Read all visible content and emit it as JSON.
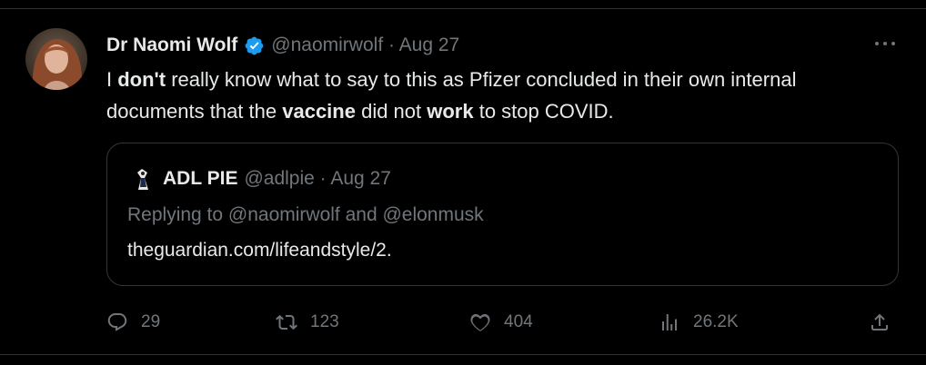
{
  "tweet": {
    "author_name": "Dr Naomi Wolf",
    "handle_time": "@naomirwolf · Aug 27",
    "text_segments": [
      {
        "text": "I ",
        "bold": false
      },
      {
        "text": "don't",
        "bold": true
      },
      {
        "text": " really know what to say to this as Pfizer concluded in their own internal documents that the ",
        "bold": false
      },
      {
        "text": "vaccine",
        "bold": true
      },
      {
        "text": " did not ",
        "bold": false
      },
      {
        "text": "work",
        "bold": true
      },
      {
        "text": " to stop COVID.",
        "bold": false
      }
    ],
    "verified_color": "#1d9bf0"
  },
  "quote": {
    "author_name": "ADL PIE",
    "handle_time": "@adlpie · Aug 27",
    "replying_to": "Replying to @naomirwolf and @elonmusk",
    "link_text": "theguardian.com/lifeandstyle/2."
  },
  "actions": {
    "reply_count": "29",
    "retweet_count": "123",
    "like_count": "404",
    "view_count": "26.2K"
  },
  "icons": {
    "more": "more-icon",
    "reply": "reply-icon",
    "retweet": "retweet-icon",
    "like": "heart-icon",
    "views": "views-icon",
    "share": "share-icon"
  }
}
